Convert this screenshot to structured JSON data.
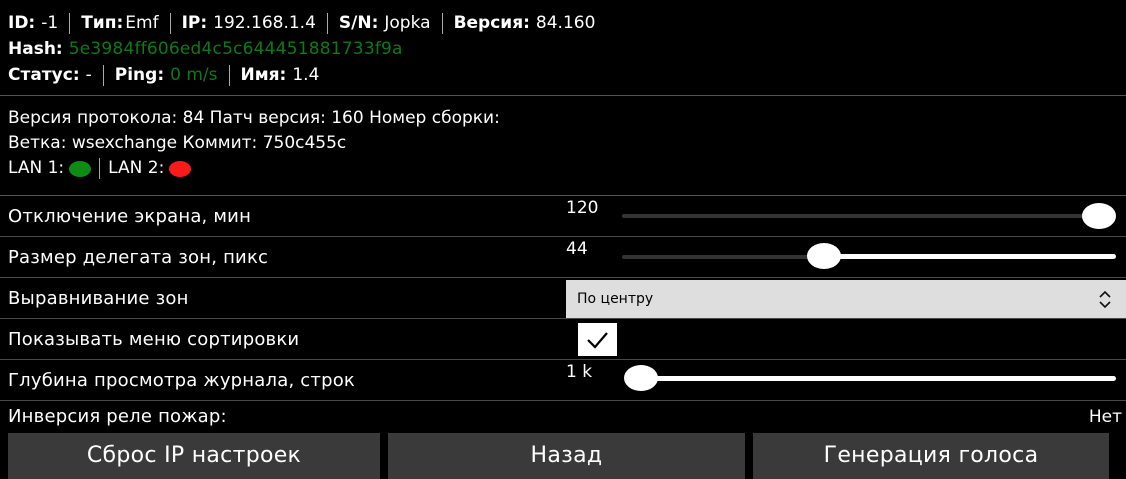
{
  "header": {
    "id_label": "ID:",
    "id_value": "-1",
    "type_label": "Тип:",
    "type_value": "Emf",
    "ip_label": "IP:",
    "ip_value": "192.168.1.4",
    "sn_label": "S/N:",
    "sn_value": "Jopka",
    "version_label": "Версия:",
    "version_value": "84.160",
    "hash_label": "Hash:",
    "hash_value": "5e3984ff606ed4c5c644451881733f9a",
    "status_label": "Статус:",
    "status_value": "-",
    "ping_label": "Ping:",
    "ping_value": "0 m/s",
    "name_label": "Имя:",
    "name_value": "1.4"
  },
  "meta": {
    "line1": "Версия протокола: 84 Патч версия: 160 Номер сборки:",
    "line2": "Ветка: wsexchange Коммит: 750c455c",
    "lan1_label": "LAN 1:",
    "lan2_label": "LAN 2:",
    "lan1_status_color": "#0f8c13",
    "lan2_status_color": "#ff1a1a"
  },
  "settings": {
    "screen_off": {
      "label": "Отключение экрана, мин",
      "value": "120",
      "level": 1.0
    },
    "zone_delegate": {
      "label": "Размер делегата зон, пикс",
      "value": "44",
      "level": 0.39
    },
    "zone_align": {
      "label": "Выравнивание зон",
      "selected": "По центру"
    },
    "show_sort_menu": {
      "label": "Показывать меню сортировки",
      "checked": true
    },
    "log_depth": {
      "label": "Глубина просмотра журнала, строк",
      "value": "1 k",
      "level": 0.0
    },
    "fire_relay_inversion": {
      "label": "Инверсия реле пожар:",
      "value": "Нет"
    }
  },
  "buttons": {
    "reset_ip": "Сброс IP настроек",
    "back": "Назад",
    "voice_gen": "Генерация голоса"
  },
  "colors": {
    "accent_green": "#0c7a16",
    "background": "#000000",
    "button_bg": "#3a3a3a"
  }
}
